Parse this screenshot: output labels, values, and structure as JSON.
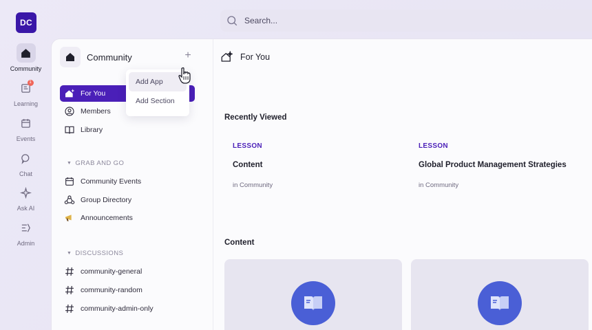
{
  "rail": {
    "avatar": "DC",
    "items": [
      {
        "label": "Community",
        "icon": "home-icon",
        "active": true
      },
      {
        "label": "Learning",
        "icon": "book-icon",
        "badge": "1"
      },
      {
        "label": "Events",
        "icon": "calendar-icon"
      },
      {
        "label": "Chat",
        "icon": "chat-icon"
      },
      {
        "label": "Ask AI",
        "icon": "sparkle-icon"
      },
      {
        "label": "Admin",
        "icon": "admin-icon"
      }
    ]
  },
  "search": {
    "placeholder": "Search..."
  },
  "sidebar": {
    "title": "Community",
    "add_label": "+",
    "items": [
      {
        "label": "For You",
        "icon": "sparkle-home-icon",
        "active": true
      },
      {
        "label": "Members",
        "icon": "user-icon"
      },
      {
        "label": "Library",
        "icon": "book-open-icon"
      }
    ],
    "sections": [
      {
        "title": "GRAB AND GO",
        "items": [
          {
            "label": "Community Events",
            "icon": "calendar-icon"
          },
          {
            "label": "Group Directory",
            "icon": "group-icon"
          },
          {
            "label": "Announcements",
            "icon": "megaphone-icon"
          }
        ]
      },
      {
        "title": "DISCUSSIONS",
        "items": [
          {
            "label": "community-general",
            "icon": "hash-icon"
          },
          {
            "label": "community-random",
            "icon": "hash-icon"
          },
          {
            "label": "community-admin-only",
            "icon": "hash-icon"
          }
        ]
      }
    ]
  },
  "dropdown": {
    "items": [
      "Add App",
      "Add Section"
    ]
  },
  "main": {
    "title": "For You",
    "recently_viewed_title": "Recently Viewed",
    "recent": [
      {
        "kind": "LESSON",
        "name": "Content",
        "location": "in Community"
      },
      {
        "kind": "LESSON",
        "name": "Global Product Management Strategies",
        "location": "in Community"
      }
    ],
    "content_title": "Content"
  },
  "colors": {
    "accent": "#4a1fb8",
    "avatar": "#3a17a8",
    "tile_icon": "#4a5fd6"
  }
}
